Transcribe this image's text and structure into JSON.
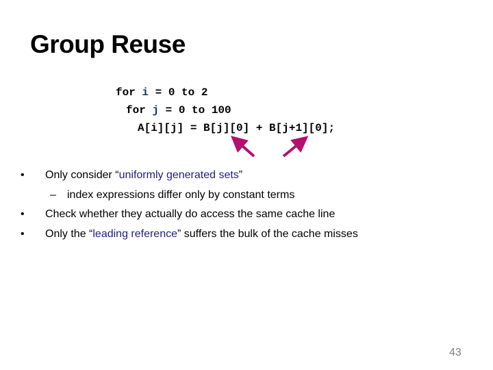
{
  "slide": {
    "title": "Group Reuse",
    "code": {
      "line1": {
        "kw": "for ",
        "var": "i",
        "rest": " = 0 to 2"
      },
      "line2": {
        "kw": "for ",
        "var": "j",
        "rest": " = 0 to 100"
      },
      "line3": "A[i][j] = B[j][0] + B[j+1][0];"
    },
    "arrow_color": "#b5106e",
    "bullets": [
      {
        "marker": "•",
        "pre": "Only consider “",
        "highlight": "uniformly generated sets",
        "post": "”"
      },
      {
        "marker": "–",
        "text": "index expressions differ only by constant terms"
      },
      {
        "marker": "•",
        "text": "Check whether they actually do access the same cache line"
      },
      {
        "marker": "•",
        "pre": "Only the “",
        "highlight": "leading reference",
        "post": "” suffers the bulk of the cache misses"
      }
    ],
    "page_number": "43"
  }
}
